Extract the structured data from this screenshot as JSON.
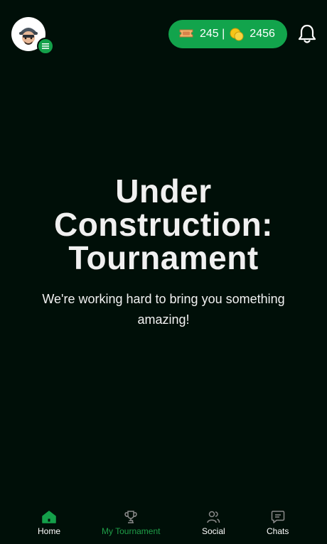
{
  "header": {
    "tickets": "245 |",
    "coins": "2456"
  },
  "hero": {
    "title": "Under Construction: Tournament",
    "subtitle": "We're working hard to bring you something amazing!"
  },
  "nav": {
    "home": "Home",
    "tournament": "My Tournament",
    "social": "Social",
    "chats": "Chats"
  },
  "colors": {
    "background": "#000f08",
    "accent": "#12a44c",
    "active_nav": "#1f9e48"
  }
}
